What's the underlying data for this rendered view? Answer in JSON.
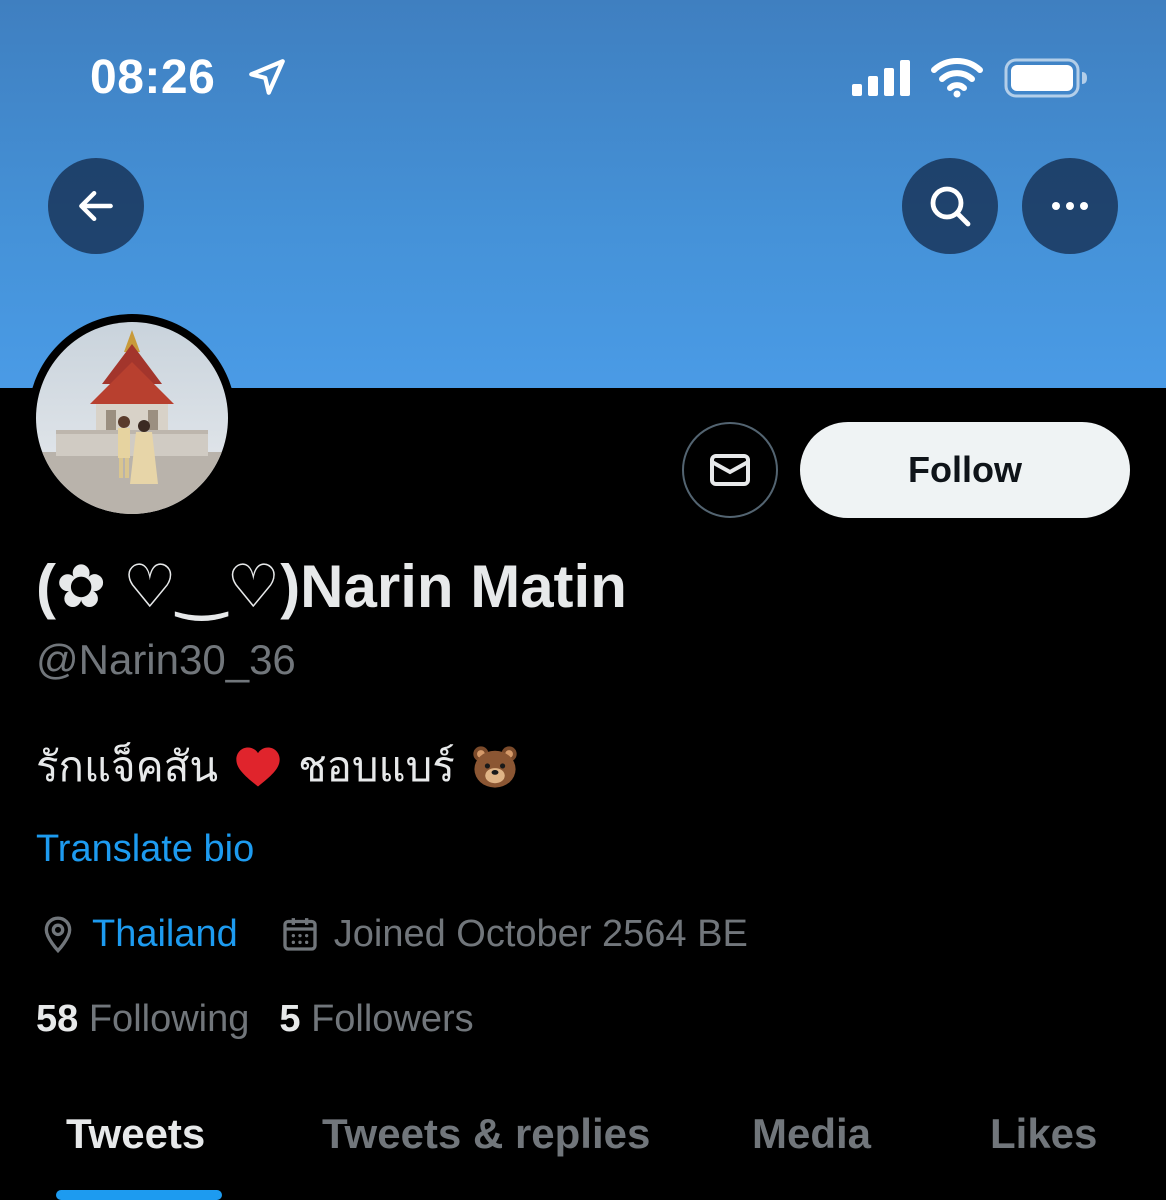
{
  "status_bar": {
    "time": "08:26"
  },
  "profile": {
    "display_name": "(✿ ♡‿♡)Narin Matin",
    "handle": "@Narin30_36",
    "bio_text_1": "รักแจ็คสัน",
    "bio_text_2": "ชอบแบร์",
    "translate_label": "Translate bio",
    "location": "Thailand",
    "joined": "Joined October 2564 BE",
    "following_count": "58",
    "following_label": "Following",
    "followers_count": "5",
    "followers_label": "Followers"
  },
  "actions": {
    "follow_label": "Follow"
  },
  "tabs": [
    {
      "label": "Tweets",
      "active": true
    },
    {
      "label": "Tweets & replies",
      "active": false
    },
    {
      "label": "Media",
      "active": false
    },
    {
      "label": "Likes",
      "active": false
    }
  ],
  "colors": {
    "accent": "#1d9bf0",
    "background": "#000000",
    "banner": "#4592d8",
    "muted_text": "#71767b"
  }
}
